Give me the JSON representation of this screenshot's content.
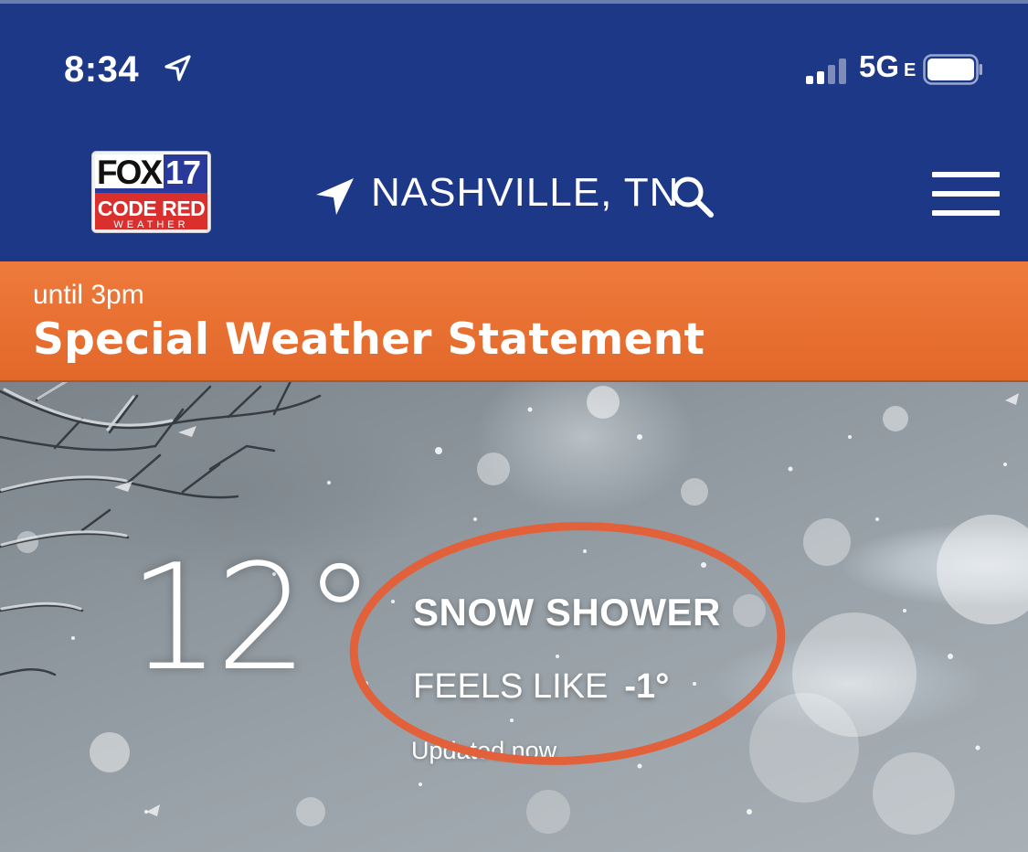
{
  "status_bar": {
    "time": "8:34",
    "network": "5G",
    "network_suffix": "E",
    "signal_bars_active": 2,
    "signal_bars_total": 4
  },
  "header": {
    "logo": {
      "line1": "FOX",
      "line2": "17",
      "line3": "CODE RED",
      "line4": "WEATHER"
    },
    "location": "NASHVILLE, TN",
    "location_icon": "location-arrow-icon",
    "search_icon": "search-icon",
    "menu_icon": "hamburger-menu-icon"
  },
  "alert": {
    "subtitle": "until 3pm",
    "title": "Special Weather Statement",
    "color": "#e8712f"
  },
  "weather": {
    "temperature": "12°",
    "condition": "SNOW SHOWER",
    "feels_like_label": "FEELS LIKE",
    "feels_like_value": "-1°",
    "updated": "Updated now"
  },
  "colors": {
    "header_bg": "#1c3887",
    "alert_bg": "#e8712f",
    "annotation_circle": "#e2613a"
  }
}
